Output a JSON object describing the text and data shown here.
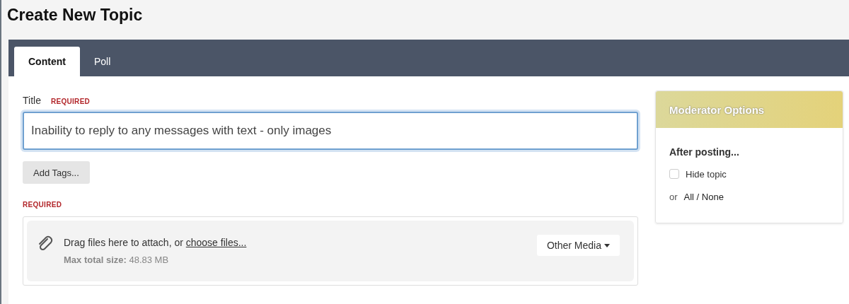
{
  "page_title": "Create New Topic",
  "tabs": [
    {
      "label": "Content",
      "selected": true
    },
    {
      "label": "Poll",
      "selected": false
    }
  ],
  "title_field": {
    "label": "Title",
    "required_badge": "REQUIRED",
    "value": "Inability to reply to any messages with text - only images"
  },
  "add_tags_button": "Add Tags...",
  "attachments": {
    "required_badge": "REQUIRED",
    "prompt": "Drag files here to attach, or ",
    "link": "choose files...",
    "limit": "**Max total size:** 48.83 MB",
    "media_button": "Other Media"
  },
  "moderator_options": {
    "title": "Moderator Options",
    "subtitle": "After posting...",
    "options": [
      {
        "label": "Hide topic",
        "checked": false
      }
    ],
    "or_label": "or",
    "all_none": "All / None"
  }
}
